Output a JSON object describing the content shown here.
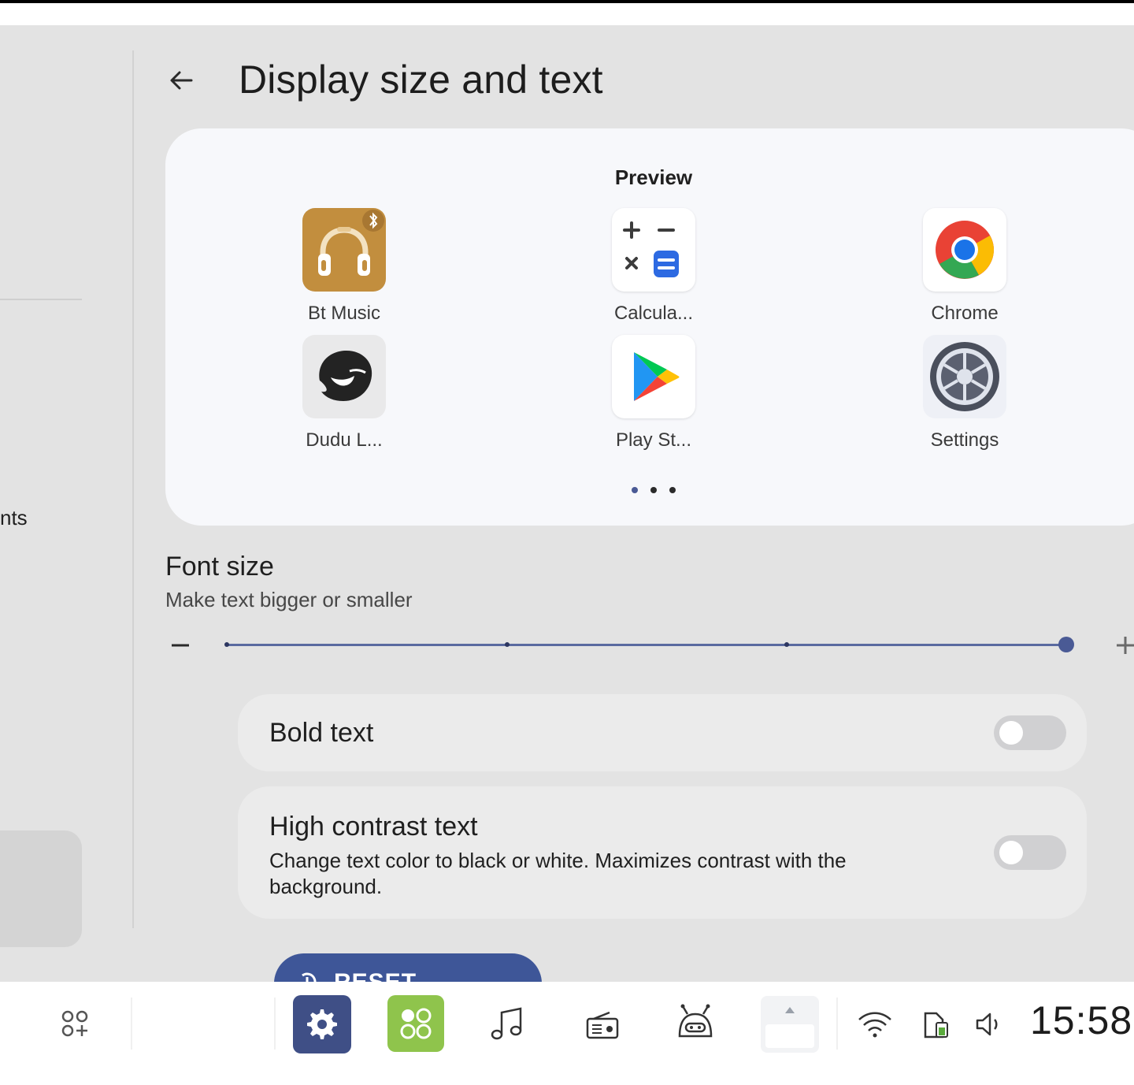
{
  "header": {
    "title": "Display size and text"
  },
  "left_pane": {
    "item_text": "nts"
  },
  "preview": {
    "label": "Preview",
    "apps": [
      {
        "label": "Bt Music",
        "icon": "headphones-bluetooth-icon"
      },
      {
        "label": "Calcula...",
        "icon": "calculator-icon"
      },
      {
        "label": "Chrome",
        "icon": "chrome-icon"
      },
      {
        "label": "Dudu L...",
        "icon": "dudu-launcher-icon"
      },
      {
        "label": "Play St...",
        "icon": "play-store-icon"
      },
      {
        "label": "Settings",
        "icon": "settings-gear-icon"
      }
    ],
    "pages": {
      "count": 3,
      "current": 1
    }
  },
  "font_size": {
    "title": "Font size",
    "subtitle": "Make text bigger or smaller",
    "steps": 4,
    "current_step": 4
  },
  "bold_text": {
    "title": "Bold text",
    "enabled": false
  },
  "high_contrast": {
    "title": "High contrast text",
    "subtitle": "Change text color to black or white. Maximizes contrast with the background.",
    "enabled": false
  },
  "reset_button": {
    "label": "RESET SETTINGS"
  },
  "taskbar": {
    "apps": [
      "app-drawer-icon",
      "settings-icon",
      "launcher-icon",
      "music-note-icon",
      "radio-icon",
      "robot-icon",
      "recent-app-icon"
    ],
    "status": [
      "wifi-icon",
      "battery-icon",
      "volume-icon"
    ],
    "clock": "15:58"
  },
  "colors": {
    "accent": "#4a5a95",
    "reset_button": "#3e5698",
    "background": "#e3e3e3",
    "card": "#f7f8fb"
  }
}
